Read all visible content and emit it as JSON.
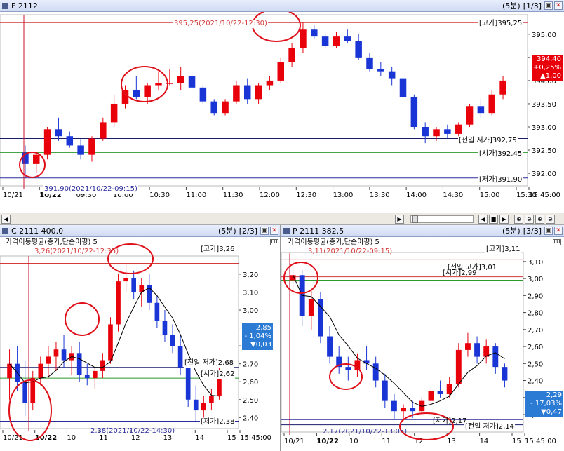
{
  "colors": {
    "up": "#e8000b",
    "down": "#1a35d6",
    "high_line": "#d43a3a",
    "open_line": "#2a9a2a",
    "low_line": "#2c2c9c",
    "prev_low_line": "#1c1c6c",
    "ma_line": "#000000",
    "crosshair": "#c8102e",
    "circle": "#e0101a",
    "price_tag_red": "#e8000b",
    "price_tag_blue": "#2b7ad4"
  },
  "main": {
    "title": "F 2112",
    "interval": "(5분)",
    "page": "[1/3]",
    "high_label": "395,25(2021/10/22-12:30)",
    "low_label": "391,90(2021/10/22-09:15)",
    "levels": {
      "high": "[고가]395,25",
      "prev_low": "[전일 저가]392,75",
      "open": "[시가]392,45",
      "low": "[저가]391,90"
    },
    "y_ticks": [
      "395,00",
      "394,50",
      "394,00",
      "393,50",
      "393,00",
      "392,50",
      "392,00"
    ],
    "x_ticks": [
      "10/21",
      "10/22",
      "09:30",
      "10:00",
      "10:30",
      "11:00",
      "11:30",
      "12:00",
      "12:30",
      "13:00",
      "13:30",
      "14:00",
      "14:30",
      "15:00",
      "15:30",
      "15:45:00"
    ],
    "price_tag": {
      "price": "394,40",
      "change_pct": "+0,25%",
      "change": "▲1,00"
    }
  },
  "call": {
    "title": "C 2111 400.0",
    "interval": "(5분)",
    "page": "[2/3]",
    "indicator": "가격이동평균(종가,단순이평) 5",
    "high_label": "3,26(2021/10/22-12:35)",
    "low_label": "2,38(2021/10/22-14:30)",
    "levels": {
      "high": "[고가]3,26",
      "prev_low": "[전일 저가]2,68",
      "open": "[시가]2,62",
      "low": "[저가]2,38"
    },
    "y_ticks": [
      "3,20",
      "3,10",
      "3,00",
      "2,90",
      "2,80",
      "2,70",
      "2,60",
      "2,50",
      "2,40"
    ],
    "x_ticks": [
      "10/21",
      "10/22",
      "10",
      "11",
      "12",
      "13",
      "14",
      "15",
      "15:45:00"
    ],
    "price_tag": {
      "price": "2,85",
      "change_pct": "- 1,04%",
      "change": "▼0,03"
    }
  },
  "put": {
    "title": "P 2111 382.5",
    "interval": "(5분)",
    "page": "[3/3]",
    "indicator": "가격이동평균(종가,단순이평) 5",
    "high_label": "3,11(2021/10/22-09:15)",
    "low_label": "2,17(2021/10/22-13:05)",
    "levels": {
      "high": "[고가]3,11",
      "prev_high": "[전일 고가]3,01",
      "open": "[시가]2,99",
      "low": "[저가]2,17",
      "prev_low": "[전일 저가]2,14"
    },
    "y_ticks": [
      "3,10",
      "3,00",
      "2,90",
      "2,80",
      "2,70",
      "2,60",
      "2,50",
      "2,40",
      "2,30",
      "2,20"
    ],
    "x_ticks": [
      "10/21",
      "10/22",
      "10",
      "11",
      "12",
      "13",
      "14",
      "15",
      "15:45:00"
    ],
    "price_tag": {
      "price": "2,29",
      "change_pct": "- 17,03%",
      "change": "▼0,47"
    }
  },
  "navbar": {
    "buttons": [
      "◀",
      "▶"
    ],
    "controls": [
      "◀",
      "■",
      "▶",
      "zoom-in",
      "zoom-out",
      "zoom-in-2",
      "zoom-out-2"
    ]
  },
  "chart_data": [
    {
      "type": "candlestick",
      "title": "F 2112",
      "series": [
        {
          "name": "F 2112",
          "values": [
            [
              392.45,
              392.6,
              391.9,
              392.2
            ],
            [
              392.2,
              392.45,
              392.0,
              392.4
            ],
            [
              392.4,
              393.0,
              392.3,
              392.95
            ],
            [
              392.95,
              393.2,
              392.7,
              392.8
            ],
            [
              392.8,
              392.9,
              392.55,
              392.6
            ],
            [
              392.6,
              392.75,
              392.3,
              392.4
            ],
            [
              392.4,
              392.8,
              392.25,
              392.75
            ],
            [
              392.75,
              393.2,
              392.7,
              393.1
            ],
            [
              393.1,
              393.7,
              393.0,
              393.5
            ],
            [
              393.5,
              393.9,
              393.4,
              393.8
            ],
            [
              393.8,
              394.1,
              393.6,
              393.65
            ],
            [
              393.65,
              393.95,
              393.5,
              393.9
            ],
            [
              393.9,
              394.2,
              393.8,
              393.95
            ],
            [
              393.95,
              394.25,
              393.9,
              393.95
            ],
            [
              393.95,
              394.3,
              393.8,
              394.1
            ],
            [
              394.1,
              394.2,
              393.8,
              393.85
            ],
            [
              393.85,
              393.9,
              393.5,
              393.55
            ],
            [
              393.55,
              393.6,
              393.25,
              393.3
            ],
            [
              393.3,
              393.6,
              393.25,
              393.55
            ],
            [
              393.55,
              394.0,
              393.5,
              393.9
            ],
            [
              393.9,
              394.05,
              393.5,
              393.6
            ],
            [
              393.6,
              393.95,
              393.5,
              393.9
            ],
            [
              393.9,
              394.1,
              393.8,
              394.0
            ],
            [
              394.0,
              394.5,
              393.95,
              394.4
            ],
            [
              394.4,
              394.8,
              394.3,
              394.7
            ],
            [
              394.7,
              395.25,
              394.6,
              395.1
            ],
            [
              395.1,
              395.2,
              394.9,
              394.95
            ],
            [
              394.95,
              395.0,
              394.7,
              394.75
            ],
            [
              394.75,
              395.05,
              394.7,
              394.95
            ],
            [
              394.95,
              395.1,
              394.8,
              394.85
            ],
            [
              394.85,
              395.0,
              394.45,
              394.5
            ],
            [
              394.5,
              394.6,
              394.2,
              394.25
            ],
            [
              394.25,
              394.4,
              394.1,
              394.2
            ],
            [
              394.2,
              394.3,
              393.9,
              394.05
            ],
            [
              394.05,
              394.2,
              393.6,
              393.65
            ],
            [
              393.65,
              393.7,
              392.95,
              393.0
            ],
            [
              393.0,
              393.1,
              392.65,
              392.8
            ],
            [
              392.8,
              393.0,
              392.7,
              392.95
            ],
            [
              392.95,
              393.05,
              392.75,
              392.85
            ],
            [
              392.85,
              393.1,
              392.8,
              393.05
            ],
            [
              393.05,
              393.5,
              393.0,
              393.45
            ],
            [
              393.45,
              393.6,
              393.2,
              393.3
            ],
            [
              393.3,
              393.8,
              393.25,
              393.7
            ],
            [
              393.7,
              394.1,
              393.6,
              394.0
            ]
          ]
        }
      ],
      "levels": {
        "high": 395.25,
        "prev_low": 392.75,
        "open": 392.45,
        "low": 391.9
      },
      "ylim": [
        391.85,
        395.3
      ]
    },
    {
      "type": "candlestick",
      "title": "C 2111 400.0",
      "series": [
        {
          "name": "C 2111 400.0",
          "values": [
            [
              2.62,
              2.78,
              2.5,
              2.7
            ],
            [
              2.7,
              2.8,
              2.55,
              2.6
            ],
            [
              2.6,
              2.72,
              2.41,
              2.48
            ],
            [
              2.48,
              2.66,
              2.44,
              2.62
            ],
            [
              2.62,
              2.74,
              2.58,
              2.7
            ],
            [
              2.7,
              2.8,
              2.62,
              2.74
            ],
            [
              2.74,
              2.82,
              2.66,
              2.78
            ],
            [
              2.78,
              2.86,
              2.68,
              2.72
            ],
            [
              2.72,
              2.8,
              2.64,
              2.76
            ],
            [
              2.76,
              2.82,
              2.6,
              2.64
            ],
            [
              2.64,
              2.7,
              2.58,
              2.62
            ],
            [
              2.62,
              2.68,
              2.56,
              2.66
            ],
            [
              2.66,
              2.76,
              2.62,
              2.72
            ],
            [
              2.72,
              2.96,
              2.7,
              2.92
            ],
            [
              2.92,
              3.2,
              2.88,
              3.16
            ],
            [
              3.16,
              3.26,
              3.1,
              3.18
            ],
            [
              3.18,
              3.22,
              3.06,
              3.1
            ],
            [
              3.1,
              3.18,
              3.02,
              3.14
            ],
            [
              3.14,
              3.2,
              3.0,
              3.04
            ],
            [
              3.04,
              3.08,
              2.9,
              2.94
            ],
            [
              2.94,
              3.0,
              2.82,
              2.86
            ],
            [
              2.86,
              2.92,
              2.76,
              2.8
            ],
            [
              2.8,
              2.86,
              2.64,
              2.68
            ],
            [
              2.68,
              2.72,
              2.46,
              2.5
            ],
            [
              2.5,
              2.58,
              2.38,
              2.44
            ],
            [
              2.44,
              2.52,
              2.4,
              2.48
            ],
            [
              2.48,
              2.56,
              2.44,
              2.52
            ],
            [
              2.52,
              2.7,
              2.5,
              2.66
            ]
          ]
        }
      ],
      "levels": {
        "high": 3.26,
        "prev_low": 2.68,
        "open": 2.62,
        "low": 2.38
      },
      "ylim": [
        2.37,
        3.27
      ]
    },
    {
      "type": "candlestick",
      "title": "P 2111 382.5",
      "series": [
        {
          "name": "P 2111 382.5",
          "values": [
            [
              2.99,
              3.11,
              2.9,
              3.02
            ],
            [
              3.02,
              3.05,
              2.72,
              2.78
            ],
            [
              2.78,
              2.94,
              2.7,
              2.88
            ],
            [
              2.88,
              2.92,
              2.62,
              2.66
            ],
            [
              2.66,
              2.72,
              2.5,
              2.54
            ],
            [
              2.54,
              2.6,
              2.44,
              2.48
            ],
            [
              2.48,
              2.54,
              2.4,
              2.46
            ],
            [
              2.46,
              2.56,
              2.42,
              2.52
            ],
            [
              2.52,
              2.6,
              2.46,
              2.5
            ],
            [
              2.5,
              2.54,
              2.36,
              2.4
            ],
            [
              2.4,
              2.44,
              2.24,
              2.28
            ],
            [
              2.28,
              2.32,
              2.17,
              2.22
            ],
            [
              2.22,
              2.26,
              2.17,
              2.24
            ],
            [
              2.24,
              2.28,
              2.18,
              2.22
            ],
            [
              2.22,
              2.3,
              2.2,
              2.28
            ],
            [
              2.28,
              2.36,
              2.26,
              2.34
            ],
            [
              2.34,
              2.4,
              2.3,
              2.32
            ],
            [
              2.32,
              2.42,
              2.3,
              2.38
            ],
            [
              2.38,
              2.62,
              2.36,
              2.58
            ],
            [
              2.58,
              2.68,
              2.54,
              2.62
            ],
            [
              2.62,
              2.66,
              2.5,
              2.54
            ],
            [
              2.54,
              2.64,
              2.5,
              2.6
            ],
            [
              2.6,
              2.62,
              2.44,
              2.48
            ],
            [
              2.48,
              2.5,
              2.36,
              2.4
            ]
          ]
        }
      ],
      "levels": {
        "high": 3.11,
        "prev_high": 3.01,
        "open": 2.99,
        "low": 2.17,
        "prev_low": 2.14
      },
      "ylim": [
        2.13,
        3.12
      ]
    }
  ]
}
